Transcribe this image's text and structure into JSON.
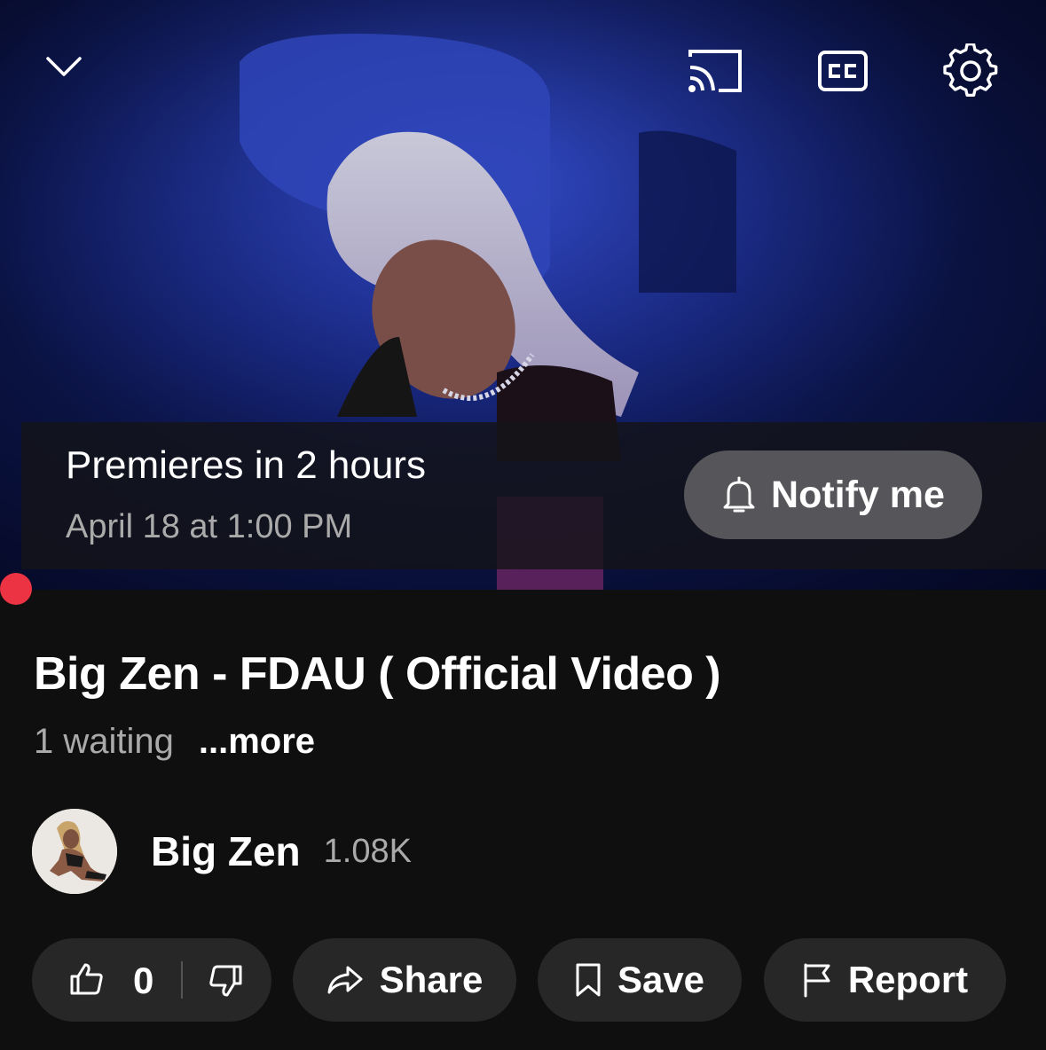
{
  "player": {
    "premiere_title": "Premieres in 2 hours",
    "premiere_date": "April 18 at 1:00 PM",
    "notify_label": "Notify me",
    "progress_color": "#ec3344",
    "icons": [
      "chevron-down-icon",
      "cast-icon",
      "closed-captions-icon",
      "settings-gear-icon",
      "bell-icon"
    ]
  },
  "video": {
    "title": "Big Zen - FDAU ( Official Video )",
    "waiting": "1 waiting",
    "more_label": "...more"
  },
  "channel": {
    "name": "Big Zen",
    "subscribers": "1.08K"
  },
  "actions": {
    "like_count": "0",
    "share_label": "Share",
    "save_label": "Save",
    "report_label": "Report",
    "icons": [
      "thumbs-up-icon",
      "thumbs-down-icon",
      "share-arrow-icon",
      "bookmark-icon",
      "flag-icon"
    ]
  },
  "colors": {
    "background": "#0f0f0f",
    "button_bg": "#272727",
    "notify_bg": "#56565a",
    "secondary_text": "#aaaaaa"
  }
}
